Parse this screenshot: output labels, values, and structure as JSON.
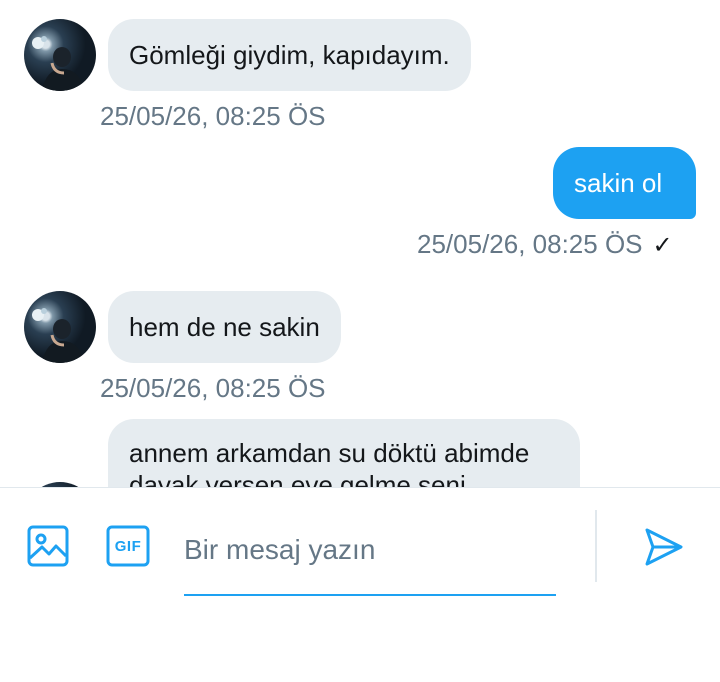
{
  "messages": [
    {
      "direction": "received",
      "text": "Gömleği giydim, kapıdayım.",
      "timestamp": "25/05/26, 08:25 ÖS"
    },
    {
      "direction": "sent",
      "text": "sakin ol",
      "timestamp": "25/05/26, 08:25 ÖS",
      "status_icon": "check-icon"
    },
    {
      "direction": "received",
      "text": "hem de ne sakin",
      "timestamp": "25/05/26, 08:25 ÖS"
    },
    {
      "direction": "received",
      "text_lines": [
        "annem arkamdan su döktü abimde",
        "dayak yersen eve gelme seni"
      ]
    }
  ],
  "composer": {
    "image_icon": "image-icon",
    "gif_icon": "gif-icon",
    "gif_label": "GIF",
    "placeholder": "Bir mesaj yazın",
    "send_icon": "send-icon"
  },
  "colors": {
    "accent": "#1da1f2",
    "received_bubble": "#e6ecf0",
    "timestamp": "#657786"
  }
}
